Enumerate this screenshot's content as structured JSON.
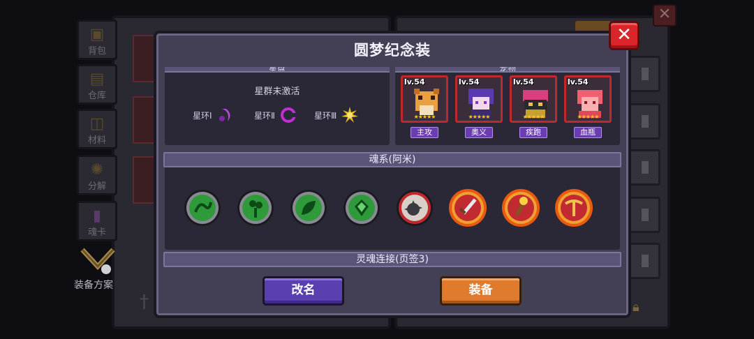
{
  "background": {
    "side_tabs": [
      {
        "label": "背包",
        "icon": "bag-icon"
      },
      {
        "label": "仓库",
        "icon": "warehouse-icon"
      },
      {
        "label": "材料",
        "icon": "materials-icon"
      },
      {
        "label": "分解",
        "icon": "decompose-icon"
      },
      {
        "label": "魂卡",
        "icon": "soul-card-icon"
      }
    ],
    "scheme_label": "装备方案"
  },
  "dialog": {
    "title": "圆梦纪念装",
    "close_icon": "close-icon",
    "constellation": {
      "header": "星盘",
      "status": "星群未激活",
      "rings": [
        {
          "label": "星环Ⅰ",
          "icon": "purple-crescent-icon",
          "color": "#b24ad8"
        },
        {
          "label": "星环Ⅱ",
          "icon": "magenta-ring-icon",
          "color": "#c030d0"
        },
        {
          "label": "星环Ⅲ",
          "icon": "gold-sun-icon",
          "color": "#e8c020"
        }
      ]
    },
    "companions": {
      "header": "宠物",
      "pets": [
        {
          "level": "lv.54",
          "stars": "★★★★★",
          "role": "主攻",
          "icon": "tiger-pet-icon"
        },
        {
          "level": "lv.54",
          "stars": "★★★★★",
          "role": "奥义",
          "icon": "purple-hair-pet-icon"
        },
        {
          "level": "lv.54",
          "stars": "★★★★★",
          "role": "疾跑",
          "icon": "masked-pet-icon"
        },
        {
          "level": "lv.54",
          "stars": "★★★★★",
          "role": "血瓶",
          "icon": "pink-pet-icon"
        }
      ]
    },
    "soul_section": {
      "header": "魂系(阿米)",
      "skills": [
        {
          "icon": "green-serpent-skill-icon",
          "tier": "green"
        },
        {
          "icon": "green-clover-skill-icon",
          "tier": "green"
        },
        {
          "icon": "green-leaf-skill-icon",
          "tier": "green"
        },
        {
          "icon": "green-emerald-skill-icon",
          "tier": "green"
        },
        {
          "icon": "red-spiked-ball-skill-icon",
          "tier": "red"
        },
        {
          "icon": "flame-sword-skill-icon",
          "tier": "flame"
        },
        {
          "icon": "flame-torch-skill-icon",
          "tier": "flame"
        },
        {
          "icon": "flame-crossbow-skill-icon",
          "tier": "flame"
        }
      ]
    },
    "link_section": {
      "header": "灵魂连接(页签3)"
    },
    "buttons": {
      "rename": "改名",
      "equip": "装备"
    }
  }
}
